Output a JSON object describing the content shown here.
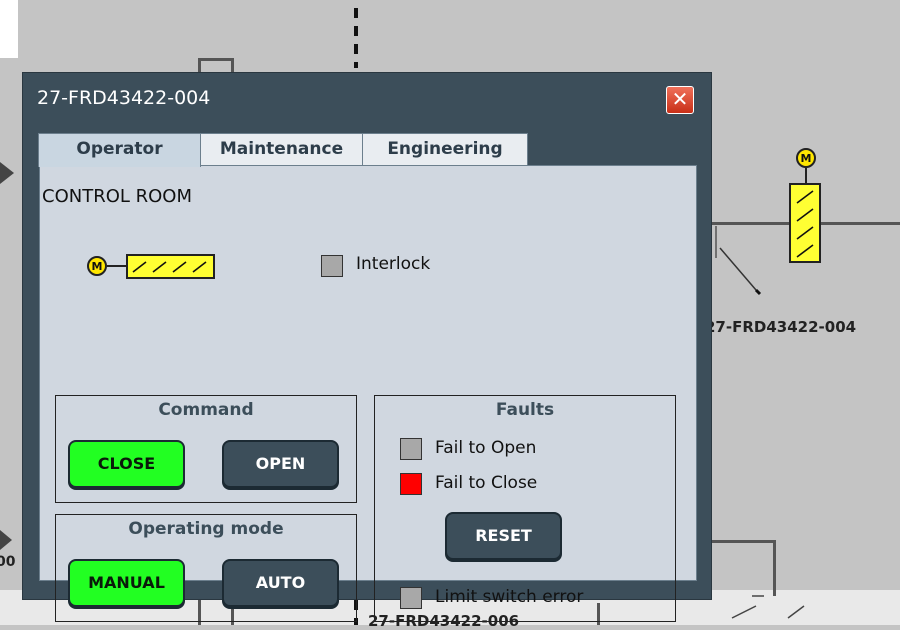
{
  "background": {
    "valve_tag": "27-FRD43422-004",
    "bottom_tag": "27-FRD43422-006",
    "left_edge_text": "00",
    "motor_letter": "M",
    "damper_glyphs": "⁄⁄⁄⁄"
  },
  "dialog": {
    "title": "27-FRD43422-004",
    "close_glyph": "✕",
    "tabs": [
      {
        "label": "Operator",
        "active": true
      },
      {
        "label": "Maintenance",
        "active": false
      },
      {
        "label": "Engineering",
        "active": false
      }
    ],
    "location_label": "CONTROL ROOM",
    "valve_icon": {
      "motor_letter": "M",
      "damper_glyphs": "⁄⁄⁄⁄"
    },
    "interlock": {
      "label": "Interlock",
      "state_color": "#a8a8a8"
    },
    "command": {
      "title": "Command",
      "close_label": "CLOSE",
      "open_label": "OPEN",
      "active": "CLOSE"
    },
    "operating_mode": {
      "title": "Operating mode",
      "manual_label": "MANUAL",
      "auto_label": "AUTO",
      "active": "MANUAL"
    },
    "faults": {
      "title": "Faults",
      "items": [
        {
          "label": "Fail to Open",
          "state_color": "#a8a8a8"
        },
        {
          "label": "Fail to Close",
          "state_color": "#ff0000"
        }
      ],
      "reset_label": "RESET",
      "limit_switch": {
        "label": "Limit switch error",
        "state_color": "#a8a8a8"
      }
    }
  },
  "colors": {
    "active_green": "#22ff22",
    "button_dark": "#3c4e5a",
    "fault_red": "#ff0000",
    "indicator_grey": "#a8a8a8"
  }
}
